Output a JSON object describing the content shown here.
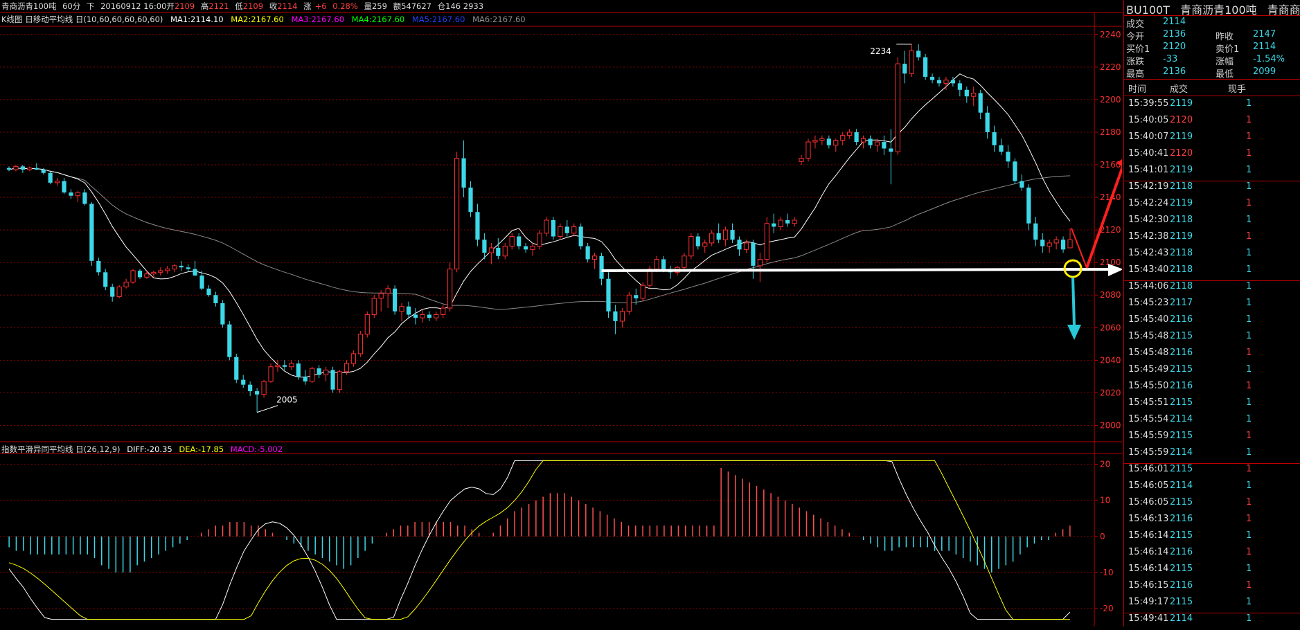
{
  "topbar": {
    "name": "青商沥青100吨",
    "period": "60分",
    "dir": "下",
    "datetime": "20160912 16:00",
    "open_label": "开",
    "open": "2109",
    "high_label": "高",
    "high": "2121",
    "low_label": "低",
    "low": "2109",
    "close_label": "收",
    "close": "2114",
    "change_label": "涨",
    "change": "+6",
    "pct": "0.28%",
    "volume": "量259",
    "amount": "额547627",
    "position": "仓146 2933"
  },
  "ma_legend": {
    "title": "K线图 日移动平均线 日(10,60,60,60,60,60)",
    "ma1": "MA1:2114.10",
    "ma2": "MA2:2167.60",
    "ma3": "MA3:2167.60",
    "ma4": "MA4:2167.60",
    "ma5": "MA5:2167.60",
    "ma6": "MA6:2167.60"
  },
  "macd_legend": {
    "title": "指数平滑异同平均线 日(26,12,9)",
    "diff": "DIFF:-20.35",
    "dea": "DEA:-17.85",
    "macd": "MACD:-5.002"
  },
  "colors": {
    "up": "#ff3030",
    "down": "#3dd8e8",
    "grid": "#8b0000",
    "ma1": "#ffffff",
    "ma2": "#ffff00",
    "ma3": "#ff00ff",
    "ma4": "#00ff00",
    "ma5": "#0000ff",
    "ma6": "#808080"
  },
  "chart_data": {
    "type": "candlestick",
    "price_axis": {
      "ticks": [
        "2240",
        "2220",
        "2200",
        "2180",
        "2160",
        "2140",
        "2120",
        "2100",
        "2080",
        "2060",
        "2040",
        "2020",
        "2000"
      ],
      "ylim": [
        1990,
        2245
      ]
    },
    "macd_axis": {
      "ticks": [
        "20",
        "10",
        "0",
        "-10",
        "-20"
      ],
      "ylim": [
        -25,
        23
      ]
    },
    "annotations": {
      "high_label": "2234",
      "low_label": "2005"
    },
    "candles": [
      [
        2158,
        2159,
        2156,
        2157
      ],
      [
        2157,
        2160,
        2156,
        2159
      ],
      [
        2159,
        2160,
        2155,
        2157
      ],
      [
        2157,
        2159,
        2156,
        2158
      ],
      [
        2158,
        2161,
        2157,
        2157
      ],
      [
        2157,
        2158,
        2154,
        2155
      ],
      [
        2155,
        2156,
        2148,
        2149
      ],
      [
        2149,
        2152,
        2147,
        2150
      ],
      [
        2150,
        2152,
        2142,
        2143
      ],
      [
        2143,
        2145,
        2139,
        2141
      ],
      [
        2141,
        2144,
        2137,
        2143
      ],
      [
        2143,
        2145,
        2135,
        2136
      ],
      [
        2136,
        2137,
        2098,
        2101
      ],
      [
        2101,
        2103,
        2092,
        2094
      ],
      [
        2094,
        2096,
        2083,
        2085
      ],
      [
        2085,
        2087,
        2076,
        2079
      ],
      [
        2079,
        2086,
        2078,
        2085
      ],
      [
        2085,
        2090,
        2084,
        2088
      ],
      [
        2088,
        2096,
        2087,
        2095
      ],
      [
        2095,
        2096,
        2090,
        2091
      ],
      [
        2091,
        2095,
        2090,
        2093
      ],
      [
        2093,
        2095,
        2091,
        2094
      ],
      [
        2094,
        2097,
        2092,
        2095
      ],
      [
        2095,
        2098,
        2093,
        2096
      ],
      [
        2096,
        2099,
        2094,
        2098
      ],
      [
        2098,
        2101,
        2095,
        2097
      ],
      [
        2097,
        2099,
        2094,
        2096
      ],
      [
        2096,
        2101,
        2093,
        2092
      ],
      [
        2092,
        2095,
        2083,
        2084
      ],
      [
        2084,
        2086,
        2079,
        2080
      ],
      [
        2080,
        2082,
        2073,
        2075
      ],
      [
        2075,
        2077,
        2060,
        2062
      ],
      [
        2062,
        2064,
        2040,
        2042
      ],
      [
        2042,
        2044,
        2026,
        2028
      ],
      [
        2028,
        2031,
        2023,
        2025
      ],
      [
        2025,
        2027,
        2018,
        2021
      ],
      [
        2021,
        2023,
        2008,
        2019
      ],
      [
        2019,
        2028,
        2017,
        2027
      ],
      [
        2027,
        2038,
        2026,
        2036
      ],
      [
        2036,
        2040,
        2033,
        2037
      ],
      [
        2037,
        2040,
        2034,
        2036
      ],
      [
        2036,
        2040,
        2034,
        2038
      ],
      [
        2038,
        2040,
        2028,
        2030
      ],
      [
        2030,
        2034,
        2025,
        2027
      ],
      [
        2027,
        2036,
        2026,
        2035
      ],
      [
        2035,
        2037,
        2029,
        2031
      ],
      [
        2031,
        2036,
        2027,
        2034
      ],
      [
        2034,
        2036,
        2020,
        2022
      ],
      [
        2022,
        2034,
        2020,
        2033
      ],
      [
        2033,
        2040,
        2031,
        2038
      ],
      [
        2038,
        2046,
        2036,
        2044
      ],
      [
        2044,
        2058,
        2042,
        2056
      ],
      [
        2056,
        2070,
        2054,
        2068
      ],
      [
        2068,
        2080,
        2066,
        2078
      ],
      [
        2078,
        2083,
        2070,
        2081
      ],
      [
        2081,
        2086,
        2072,
        2084
      ],
      [
        2084,
        2086,
        2068,
        2070
      ],
      [
        2070,
        2075,
        2064,
        2073
      ],
      [
        2073,
        2076,
        2066,
        2068
      ],
      [
        2068,
        2072,
        2062,
        2066
      ],
      [
        2066,
        2071,
        2063,
        2068
      ],
      [
        2068,
        2070,
        2064,
        2066
      ],
      [
        2066,
        2070,
        2064,
        2068
      ],
      [
        2068,
        2074,
        2066,
        2072
      ],
      [
        2072,
        2100,
        2070,
        2096
      ],
      [
        2096,
        2168,
        2094,
        2164
      ],
      [
        2164,
        2175,
        2140,
        2146
      ],
      [
        2146,
        2150,
        2128,
        2131
      ],
      [
        2131,
        2136,
        2110,
        2114
      ],
      [
        2114,
        2118,
        2102,
        2106
      ],
      [
        2106,
        2112,
        2099,
        2109
      ],
      [
        2109,
        2115,
        2102,
        2104
      ],
      [
        2104,
        2112,
        2102,
        2110
      ],
      [
        2110,
        2118,
        2108,
        2116
      ],
      [
        2116,
        2118,
        2108,
        2110
      ],
      [
        2110,
        2112,
        2106,
        2108
      ],
      [
        2108,
        2112,
        2104,
        2110
      ],
      [
        2110,
        2120,
        2108,
        2118
      ],
      [
        2118,
        2128,
        2116,
        2126
      ],
      [
        2126,
        2128,
        2114,
        2116
      ],
      [
        2116,
        2124,
        2114,
        2122
      ],
      [
        2122,
        2126,
        2116,
        2118
      ],
      [
        2118,
        2124,
        2116,
        2122
      ],
      [
        2122,
        2124,
        2108,
        2110
      ],
      [
        2110,
        2112,
        2100,
        2102
      ],
      [
        2102,
        2106,
        2096,
        2104
      ],
      [
        2104,
        2106,
        2086,
        2090
      ],
      [
        2090,
        2094,
        2066,
        2070
      ],
      [
        2070,
        2074,
        2056,
        2064
      ],
      [
        2064,
        2072,
        2060,
        2070
      ],
      [
        2070,
        2082,
        2068,
        2080
      ],
      [
        2080,
        2084,
        2074,
        2078
      ],
      [
        2078,
        2088,
        2076,
        2086
      ],
      [
        2086,
        2098,
        2084,
        2096
      ],
      [
        2096,
        2104,
        2094,
        2102
      ],
      [
        2102,
        2104,
        2094,
        2096
      ],
      [
        2096,
        2098,
        2090,
        2094
      ],
      [
        2094,
        2098,
        2092,
        2097
      ],
      [
        2097,
        2106,
        2095,
        2104
      ],
      [
        2104,
        2118,
        2102,
        2116
      ],
      [
        2116,
        2118,
        2108,
        2110
      ],
      [
        2110,
        2114,
        2106,
        2112
      ],
      [
        2112,
        2120,
        2110,
        2118
      ],
      [
        2118,
        2124,
        2112,
        2114
      ],
      [
        2114,
        2122,
        2110,
        2120
      ],
      [
        2120,
        2124,
        2112,
        2114
      ],
      [
        2114,
        2116,
        2104,
        2108
      ],
      [
        2108,
        2114,
        2106,
        2112
      ],
      [
        2112,
        2114,
        2090,
        2098
      ],
      [
        2098,
        2106,
        2088,
        2102
      ],
      [
        2102,
        2128,
        2100,
        2124
      ],
      [
        2124,
        2130,
        2118,
        2122
      ],
      [
        2122,
        2128,
        2120,
        2126
      ],
      [
        2126,
        2130,
        2122,
        2124
      ],
      [
        2124,
        2128,
        2122,
        2126
      ],
      [
        2162,
        2166,
        2160,
        2164
      ],
      [
        2164,
        2176,
        2162,
        2174
      ],
      [
        2174,
        2178,
        2170,
        2175
      ],
      [
        2175,
        2178,
        2172,
        2176
      ],
      [
        2176,
        2178,
        2170,
        2172
      ],
      [
        2172,
        2176,
        2168,
        2175
      ],
      [
        2175,
        2180,
        2172,
        2178
      ],
      [
        2178,
        2182,
        2176,
        2180
      ],
      [
        2180,
        2182,
        2172,
        2174
      ],
      [
        2174,
        2178,
        2170,
        2176
      ],
      [
        2176,
        2178,
        2170,
        2172
      ],
      [
        2172,
        2176,
        2168,
        2174
      ],
      [
        2174,
        2178,
        2166,
        2170
      ],
      [
        2170,
        2182,
        2148,
        2168
      ],
      [
        2168,
        2226,
        2166,
        2222
      ],
      [
        2222,
        2230,
        2210,
        2216
      ],
      [
        2216,
        2234,
        2214,
        2230
      ],
      [
        2230,
        2234,
        2224,
        2226
      ],
      [
        2226,
        2228,
        2212,
        2214
      ],
      [
        2214,
        2216,
        2210,
        2212
      ],
      [
        2212,
        2214,
        2208,
        2210
      ],
      [
        2210,
        2214,
        2206,
        2212
      ],
      [
        2212,
        2214,
        2208,
        2210
      ],
      [
        2210,
        2212,
        2202,
        2206
      ],
      [
        2206,
        2208,
        2198,
        2202
      ],
      [
        2202,
        2208,
        2196,
        2204
      ],
      [
        2204,
        2206,
        2188,
        2192
      ],
      [
        2192,
        2196,
        2176,
        2180
      ],
      [
        2180,
        2184,
        2168,
        2172
      ],
      [
        2172,
        2176,
        2166,
        2168
      ],
      [
        2168,
        2172,
        2158,
        2162
      ],
      [
        2162,
        2164,
        2148,
        2150
      ],
      [
        2150,
        2154,
        2144,
        2146
      ],
      [
        2146,
        2148,
        2120,
        2124
      ],
      [
        2124,
        2128,
        2110,
        2114
      ],
      [
        2114,
        2118,
        2106,
        2110
      ],
      [
        2110,
        2114,
        2106,
        2112
      ],
      [
        2112,
        2116,
        2108,
        2114
      ],
      [
        2114,
        2116,
        2106,
        2108
      ],
      [
        2109,
        2121,
        2109,
        2114
      ]
    ],
    "macd_histogram": [
      -3,
      -4,
      -4,
      -5,
      -5,
      -5,
      -5,
      -5,
      -5,
      -5,
      -5,
      -5,
      -6,
      -8,
      -9,
      -10,
      -10,
      -10,
      -8,
      -7,
      -6,
      -5,
      -4,
      -3,
      -2,
      -1,
      0,
      1,
      2,
      3,
      3,
      4,
      4,
      4,
      3,
      3,
      2,
      1,
      0,
      -1,
      -2,
      -3,
      -4,
      -5,
      -6,
      -7,
      -8,
      -9,
      -8,
      -6,
      -4,
      -2,
      0,
      1,
      2,
      3,
      3,
      4,
      4,
      4,
      4,
      4,
      4,
      3,
      3,
      2,
      1,
      0,
      1,
      3,
      5,
      7,
      8,
      9,
      10,
      11,
      12,
      12,
      12,
      11,
      10,
      9,
      8,
      7,
      6,
      5,
      4,
      3,
      3,
      3,
      3,
      3,
      3,
      3,
      3,
      3,
      3,
      3,
      3,
      3,
      19,
      18,
      17,
      16,
      15,
      14,
      13,
      12,
      11,
      10,
      9,
      8,
      7,
      6,
      5,
      4,
      3,
      2,
      1,
      0,
      -1,
      -2,
      -3,
      -4,
      -4,
      -3,
      -3,
      -3,
      -3,
      -3,
      -4,
      -4,
      -4,
      -5,
      -6,
      -7,
      -8,
      -9,
      -10,
      -9,
      -8,
      -7,
      -5,
      -3,
      -2,
      -1,
      -1,
      1,
      2,
      3
    ]
  },
  "annotation_arrows": {
    "level": "2095"
  },
  "panel": {
    "code": "BU100T",
    "name": "青商沥青100吨",
    "name_trunc": "青商商",
    "quote": [
      {
        "l1": "成交",
        "v1": "2114",
        "l2": "",
        "v2": ""
      },
      {
        "l1": "今开",
        "v1": "2136",
        "l2": "昨收",
        "v2": "2147"
      },
      {
        "l1": "买价1",
        "v1": "2120",
        "l2": "卖价1",
        "v2": "2114"
      },
      {
        "l1": "涨跌",
        "v1": "-33",
        "l2": "涨幅",
        "v2": "-1.54%"
      },
      {
        "l1": "最高",
        "v1": "2136",
        "l2": "最低",
        "v2": "2099"
      }
    ],
    "headers": {
      "time": "时间",
      "price": "成交",
      "vol": "现手"
    },
    "ticks": [
      {
        "t": "15:39:55",
        "p": "2119",
        "v": "1",
        "pc": "cyan",
        "vc": "cyan"
      },
      {
        "t": "15:40:05",
        "p": "2120",
        "v": "1",
        "pc": "red",
        "vc": "red"
      },
      {
        "t": "15:40:07",
        "p": "2119",
        "v": "1",
        "pc": "cyan",
        "vc": "red"
      },
      {
        "t": "15:40:41",
        "p": "2120",
        "v": "1",
        "pc": "red",
        "vc": "red"
      },
      {
        "t": "15:41:01",
        "p": "2119",
        "v": "1",
        "pc": "cyan",
        "vc": "cyan"
      },
      {
        "t": "15:42:19",
        "p": "2118",
        "v": "1",
        "pc": "cyan",
        "vc": "cyan"
      },
      {
        "t": "15:42:24",
        "p": "2119",
        "v": "1",
        "pc": "cyan",
        "vc": "red"
      },
      {
        "t": "15:42:30",
        "p": "2118",
        "v": "1",
        "pc": "cyan",
        "vc": "cyan"
      },
      {
        "t": "15:42:38",
        "p": "2119",
        "v": "1",
        "pc": "cyan",
        "vc": "red"
      },
      {
        "t": "15:42:43",
        "p": "2118",
        "v": "1",
        "pc": "cyan",
        "vc": "cyan"
      },
      {
        "t": "15:43:40",
        "p": "2118",
        "v": "1",
        "pc": "cyan",
        "vc": "cyan"
      },
      {
        "t": "15:44:06",
        "p": "2118",
        "v": "1",
        "pc": "cyan",
        "vc": "cyan"
      },
      {
        "t": "15:45:23",
        "p": "2117",
        "v": "1",
        "pc": "cyan",
        "vc": "cyan"
      },
      {
        "t": "15:45:40",
        "p": "2116",
        "v": "1",
        "pc": "cyan",
        "vc": "cyan"
      },
      {
        "t": "15:45:48",
        "p": "2115",
        "v": "1",
        "pc": "cyan",
        "vc": "cyan"
      },
      {
        "t": "15:45:48",
        "p": "2116",
        "v": "1",
        "pc": "cyan",
        "vc": "red"
      },
      {
        "t": "15:45:49",
        "p": "2115",
        "v": "1",
        "pc": "cyan",
        "vc": "cyan"
      },
      {
        "t": "15:45:50",
        "p": "2116",
        "v": "1",
        "pc": "cyan",
        "vc": "red"
      },
      {
        "t": "15:45:51",
        "p": "2115",
        "v": "1",
        "pc": "cyan",
        "vc": "cyan"
      },
      {
        "t": "15:45:54",
        "p": "2114",
        "v": "1",
        "pc": "cyan",
        "vc": "cyan"
      },
      {
        "t": "15:45:59",
        "p": "2115",
        "v": "1",
        "pc": "cyan",
        "vc": "red"
      },
      {
        "t": "15:45:59",
        "p": "2114",
        "v": "1",
        "pc": "cyan",
        "vc": "cyan"
      },
      {
        "t": "15:46:01",
        "p": "2115",
        "v": "1",
        "pc": "cyan",
        "vc": "red"
      },
      {
        "t": "15:46:05",
        "p": "2114",
        "v": "1",
        "pc": "cyan",
        "vc": "cyan"
      },
      {
        "t": "15:46:05",
        "p": "2115",
        "v": "1",
        "pc": "cyan",
        "vc": "red"
      },
      {
        "t": "15:46:13",
        "p": "2116",
        "v": "1",
        "pc": "cyan",
        "vc": "red"
      },
      {
        "t": "15:46:14",
        "p": "2115",
        "v": "1",
        "pc": "cyan",
        "vc": "cyan"
      },
      {
        "t": "15:46:14",
        "p": "2116",
        "v": "1",
        "pc": "cyan",
        "vc": "red"
      },
      {
        "t": "15:46:14",
        "p": "2115",
        "v": "1",
        "pc": "cyan",
        "vc": "cyan"
      },
      {
        "t": "15:46:15",
        "p": "2116",
        "v": "1",
        "pc": "cyan",
        "vc": "red"
      },
      {
        "t": "15:49:17",
        "p": "2115",
        "v": "1",
        "pc": "cyan",
        "vc": "cyan"
      },
      {
        "t": "15:49:41",
        "p": "2114",
        "v": "1",
        "pc": "cyan",
        "vc": "cyan"
      }
    ]
  }
}
